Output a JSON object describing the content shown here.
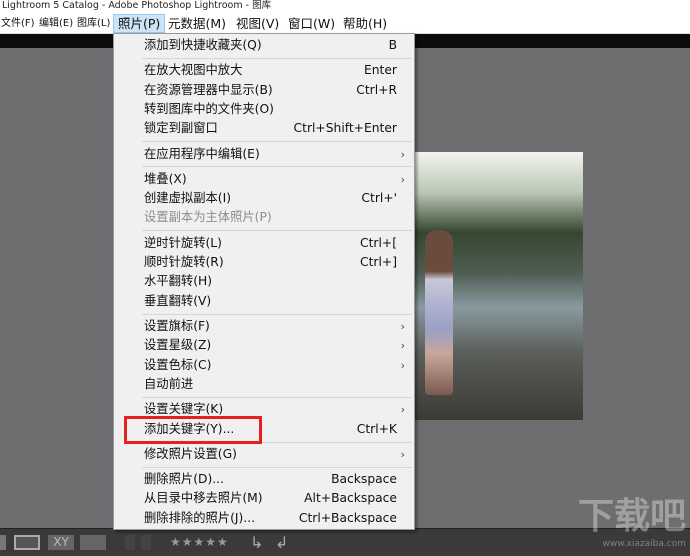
{
  "window": {
    "title": "Lightroom 5 Catalog - Adobe Photoshop Lightroom - 图库"
  },
  "menubar": [
    {
      "label": "文件(F)"
    },
    {
      "label": "编辑(E)"
    },
    {
      "label": "图库(L)"
    },
    {
      "label": "照片(P)",
      "active": true
    },
    {
      "label": "元数据(M)"
    },
    {
      "label": "视图(V)"
    },
    {
      "label": "窗口(W)"
    },
    {
      "label": "帮助(H)"
    }
  ],
  "photo_menu": {
    "groups": [
      [
        {
          "label": "添加到快捷收藏夹(Q)",
          "shortcut": "B"
        }
      ],
      [
        {
          "label": "在放大视图中放大",
          "shortcut": "Enter"
        },
        {
          "label": "在资源管理器中显示(B)",
          "shortcut": "Ctrl+R"
        },
        {
          "label": "转到图库中的文件夹(O)",
          "shortcut": ""
        },
        {
          "label": "锁定到副窗口",
          "shortcut": "Ctrl+Shift+Enter"
        }
      ],
      [
        {
          "label": "在应用程序中编辑(E)",
          "submenu": true
        }
      ],
      [
        {
          "label": "堆叠(X)",
          "submenu": true
        },
        {
          "label": "创建虚拟副本(I)",
          "shortcut": "Ctrl+'"
        },
        {
          "label": "设置副本为主体照片(P)",
          "disabled": true
        }
      ],
      [
        {
          "label": "逆时针旋转(L)",
          "shortcut": "Ctrl+["
        },
        {
          "label": "顺时针旋转(R)",
          "shortcut": "Ctrl+]"
        },
        {
          "label": "水平翻转(H)"
        },
        {
          "label": "垂直翻转(V)"
        }
      ],
      [
        {
          "label": "设置旗标(F)",
          "submenu": true
        },
        {
          "label": "设置星级(Z)",
          "submenu": true
        },
        {
          "label": "设置色标(C)",
          "submenu": true
        },
        {
          "label": "自动前进"
        }
      ],
      [
        {
          "label": "设置关键字(K)",
          "submenu": true
        },
        {
          "label": "添加关键字(Y)...",
          "shortcut": "Ctrl+K",
          "highlighted": true
        }
      ],
      [
        {
          "label": "修改照片设置(G)",
          "submenu": true
        }
      ],
      [
        {
          "label": "删除照片(D)...",
          "shortcut": "Backspace"
        },
        {
          "label": "从目录中移去照片(M)",
          "shortcut": "Alt+Backspace"
        },
        {
          "label": "删除排除的照片(J)...",
          "shortcut": "Ctrl+Backspace"
        }
      ]
    ]
  },
  "toolbar": {
    "stars": "★★★★★",
    "xy_label": "XY"
  },
  "watermark": {
    "text": "下载吧",
    "url": "www.xiazaiba.com"
  },
  "colors": {
    "highlight_box": "#e52020",
    "menu_active": "#cce4f7"
  }
}
